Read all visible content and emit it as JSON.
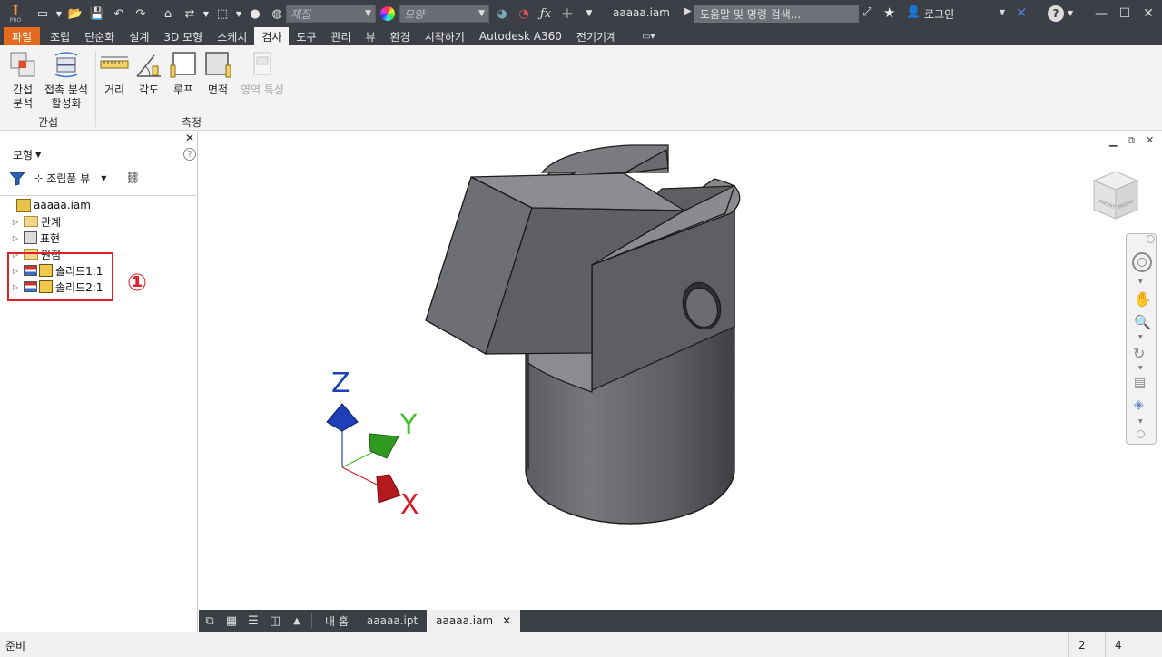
{
  "titlebar": {
    "app_icon": "inventor-pro-icon",
    "material_placeholder": "재질",
    "appearance_placeholder": "모양",
    "doc_title": "aaaaa.iam",
    "search_placeholder": "도움말 및 명령 검색...",
    "login_label": "로그인"
  },
  "ribbon_tabs": [
    {
      "label": "파일",
      "state": "file"
    },
    {
      "label": "조립",
      "state": ""
    },
    {
      "label": "단순화",
      "state": ""
    },
    {
      "label": "설계",
      "state": ""
    },
    {
      "label": "3D 모형",
      "state": ""
    },
    {
      "label": "스케치",
      "state": ""
    },
    {
      "label": "검사",
      "state": "active"
    },
    {
      "label": "도구",
      "state": ""
    },
    {
      "label": "관리",
      "state": ""
    },
    {
      "label": "뷰",
      "state": ""
    },
    {
      "label": "환경",
      "state": ""
    },
    {
      "label": "시작하기",
      "state": ""
    },
    {
      "label": "Autodesk A360",
      "state": ""
    },
    {
      "label": "전기기계",
      "state": ""
    }
  ],
  "ribbon": {
    "interference": {
      "line1": "간섭",
      "line2": "분석"
    },
    "contact": {
      "line1": "접촉 분석",
      "line2": "활성화"
    },
    "group_interference": "간섭",
    "distance": "거리",
    "angle": "각도",
    "loop": "루프",
    "area": "면적",
    "region_props": "영역 특성",
    "group_measure": "측정"
  },
  "browser": {
    "title": "모형",
    "view_label": "조립품 뷰",
    "tree": [
      {
        "label": "aaaaa.iam"
      },
      {
        "label": "관계"
      },
      {
        "label": "표현"
      },
      {
        "label": "원점"
      },
      {
        "label": "솔리드1:1"
      },
      {
        "label": "솔리드2:1"
      }
    ]
  },
  "annotation": {
    "marker": "①",
    "color": "#e0202a"
  },
  "viewport": {
    "axis_x": "X",
    "axis_y": "Y",
    "axis_z": "Z",
    "viewcube_faces": [
      "FRONT",
      "RIGHT"
    ]
  },
  "doc_tabs": {
    "home": "내 홈",
    "tab1": "aaaaa.ipt",
    "tab2": "aaaaa.iam"
  },
  "status": {
    "text": "준비",
    "count1": "2",
    "count2": "4"
  },
  "colors": {
    "titlebar_bg": "#3c3f45",
    "file_tab": "#e3691c",
    "part_gray": "#6b6c70",
    "axis_x": "#d01f26",
    "axis_y": "#44c22b",
    "axis_z": "#1e3fb5"
  }
}
